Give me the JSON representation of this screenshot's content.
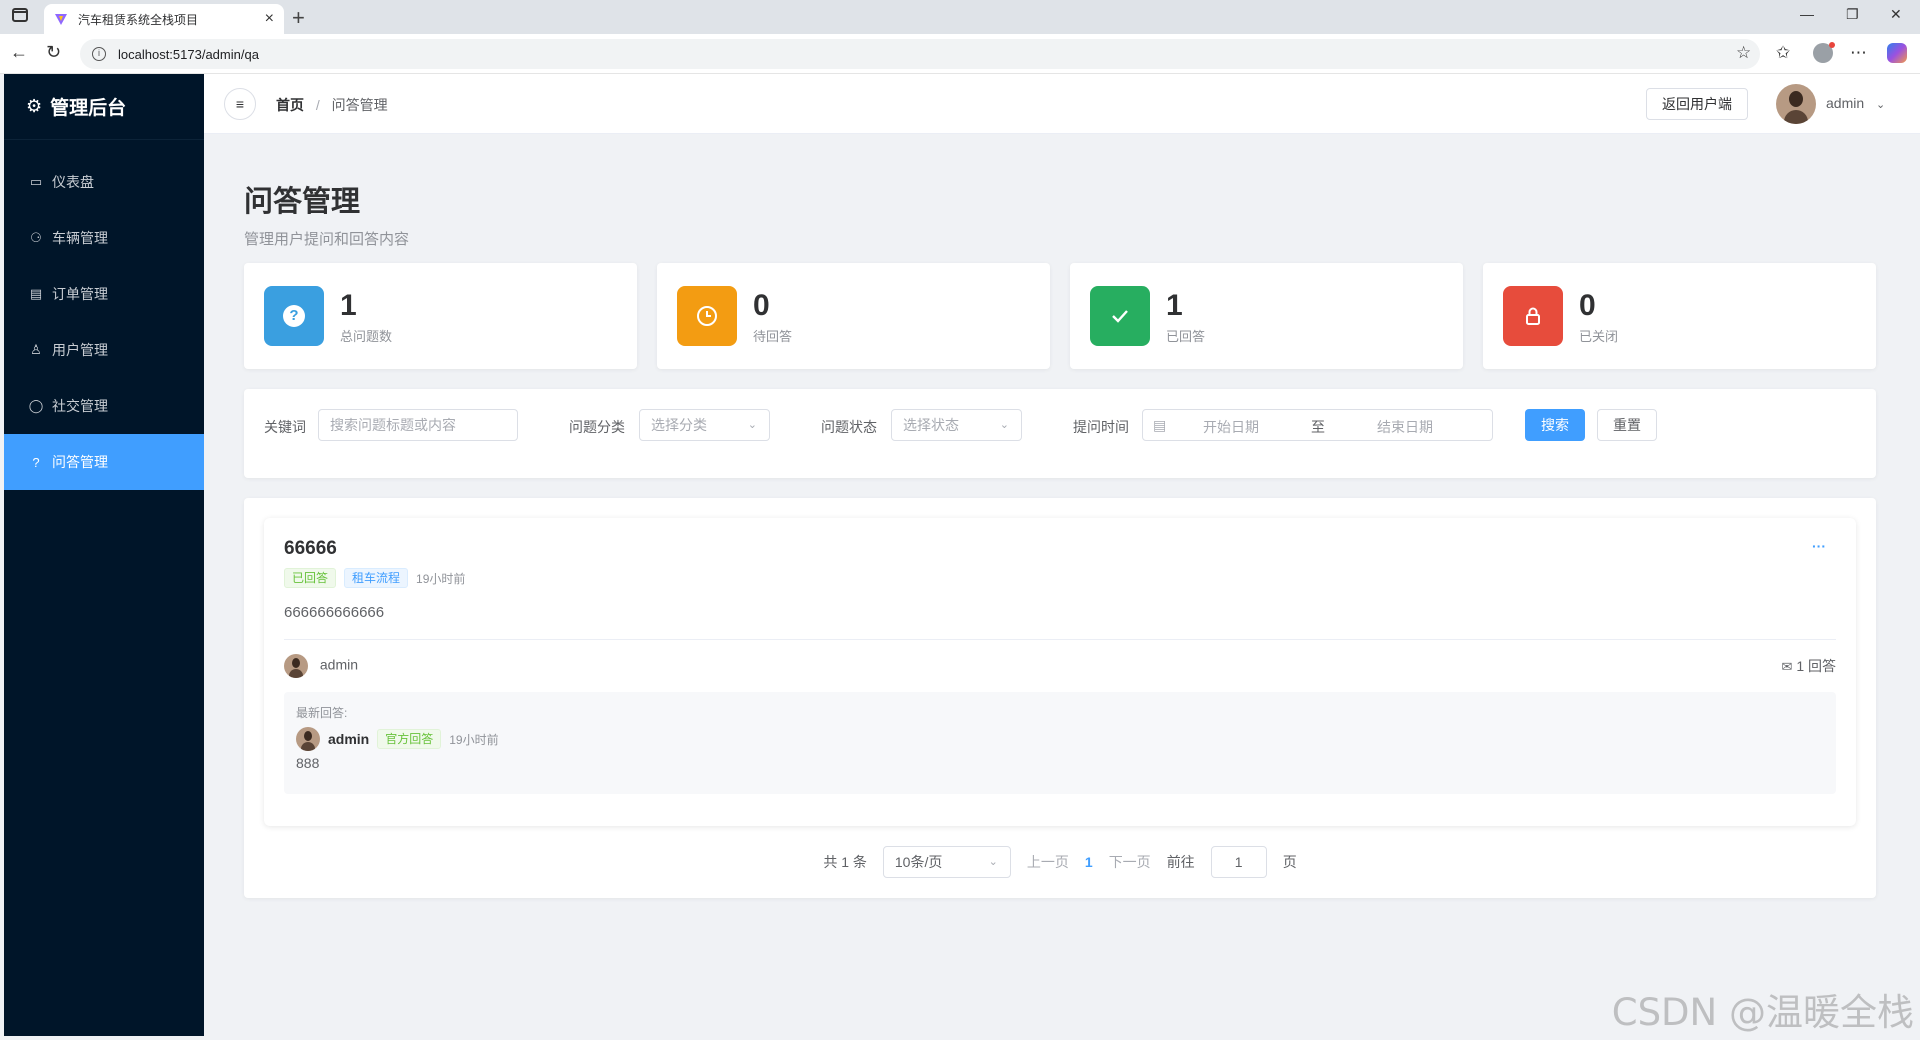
{
  "browser": {
    "tab_title": "汽车租赁系统全栈项目",
    "url": "localhost:5173/admin/qa"
  },
  "sidebar": {
    "brand": "管理后台",
    "items": [
      {
        "label": "仪表盘",
        "icon": "dashboard-icon"
      },
      {
        "label": "车辆管理",
        "icon": "bike-icon"
      },
      {
        "label": "订单管理",
        "icon": "document-icon"
      },
      {
        "label": "用户管理",
        "icon": "user-icon"
      },
      {
        "label": "社交管理",
        "icon": "chat-icon"
      },
      {
        "label": "问答管理",
        "icon": "question-icon",
        "active": true
      }
    ]
  },
  "header": {
    "breadcrumb_home": "首页",
    "breadcrumb_sep": "/",
    "breadcrumb_current": "问答管理",
    "back_button": "返回用户端",
    "username": "admin"
  },
  "page": {
    "title": "问答管理",
    "subtitle": "管理用户提问和回答内容"
  },
  "stats": [
    {
      "value": "1",
      "label": "总问题数",
      "color": "#3a9fe0",
      "icon": "question-icon"
    },
    {
      "value": "0",
      "label": "待回答",
      "color": "#f39c12",
      "icon": "clock-icon"
    },
    {
      "value": "1",
      "label": "已回答",
      "color": "#27ae60",
      "icon": "check-icon"
    },
    {
      "value": "0",
      "label": "已关闭",
      "color": "#e74c3c",
      "icon": "lock-icon"
    }
  ],
  "filter": {
    "keyword_label": "关键词",
    "keyword_placeholder": "搜索问题标题或内容",
    "category_label": "问题分类",
    "category_placeholder": "选择分类",
    "status_label": "问题状态",
    "status_placeholder": "选择状态",
    "time_label": "提问时间",
    "start_placeholder": "开始日期",
    "range_sep": "至",
    "end_placeholder": "结束日期",
    "search_button": "搜索",
    "reset_button": "重置"
  },
  "question": {
    "title": "66666",
    "status_tag": "已回答",
    "category_tag": "租车流程",
    "time": "19小时前",
    "content": "666666666666",
    "author": "admin",
    "answer_count": "1 回答",
    "latest_label": "最新回答:",
    "answer_author": "admin",
    "answer_tag": "官方回答",
    "answer_time": "19小时前",
    "answer_content": "888"
  },
  "pagination": {
    "total": "共 1 条",
    "page_size": "10条/页",
    "prev": "上一页",
    "current": "1",
    "next": "下一页",
    "goto": "前往",
    "goto_value": "1",
    "page_suffix": "页"
  },
  "watermark": "CSDN @温暖全栈"
}
